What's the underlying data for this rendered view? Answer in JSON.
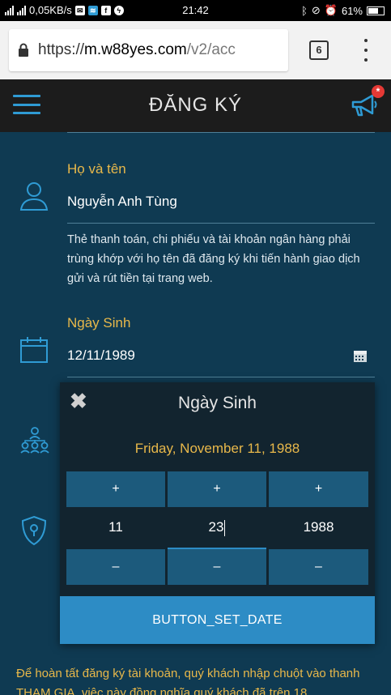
{
  "status_bar": {
    "left_text": "0,05KB/s",
    "time": "21:42",
    "battery": "61%",
    "icons": [
      "signal-icon",
      "signal-4g-icon",
      "mail-icon",
      "wifi-app-icon",
      "facebook-icon",
      "messenger-icon",
      "bluetooth-icon",
      "mute-icon",
      "alarm-icon",
      "battery-icon"
    ]
  },
  "browser": {
    "url_proto": "https://",
    "url_host": "m.w88yes.com",
    "url_path": "/v2/acc",
    "tab_count": "6"
  },
  "header": {
    "title": "ĐĂNG KÝ",
    "badge": "*"
  },
  "form": {
    "name_label": "Họ và tên",
    "name_value": "Nguyễn Anh Tùng",
    "name_hint": "Thẻ thanh toán, chi phiếu và tài khoản ngân hàng phải trùng khớp với họ tên đã đăng ký khi tiến hành giao dịch gửi và rút tiền tại trang web.",
    "dob_label": "Ngày Sinh",
    "dob_value": "12/11/1989"
  },
  "picker": {
    "close": "✖",
    "title": "Ngày Sinh",
    "selected_date": "Friday, November 11, 1988",
    "plus": "+",
    "minus": "–",
    "month": "11",
    "day": "23",
    "year": "1988",
    "set_button": "BUTTON_SET_DATE"
  },
  "footer": {
    "text": "Để hoàn tất đăng ký tài khoản, quý khách nhập chuột vào thanh THAM GIA, việc này đồng nghĩa quý khách đã trên 18"
  },
  "colors": {
    "background": "#0f3a52",
    "accent_gold": "#e8b84a",
    "accent_blue": "#2d8cc5",
    "header_bg": "#1c1c1c"
  }
}
